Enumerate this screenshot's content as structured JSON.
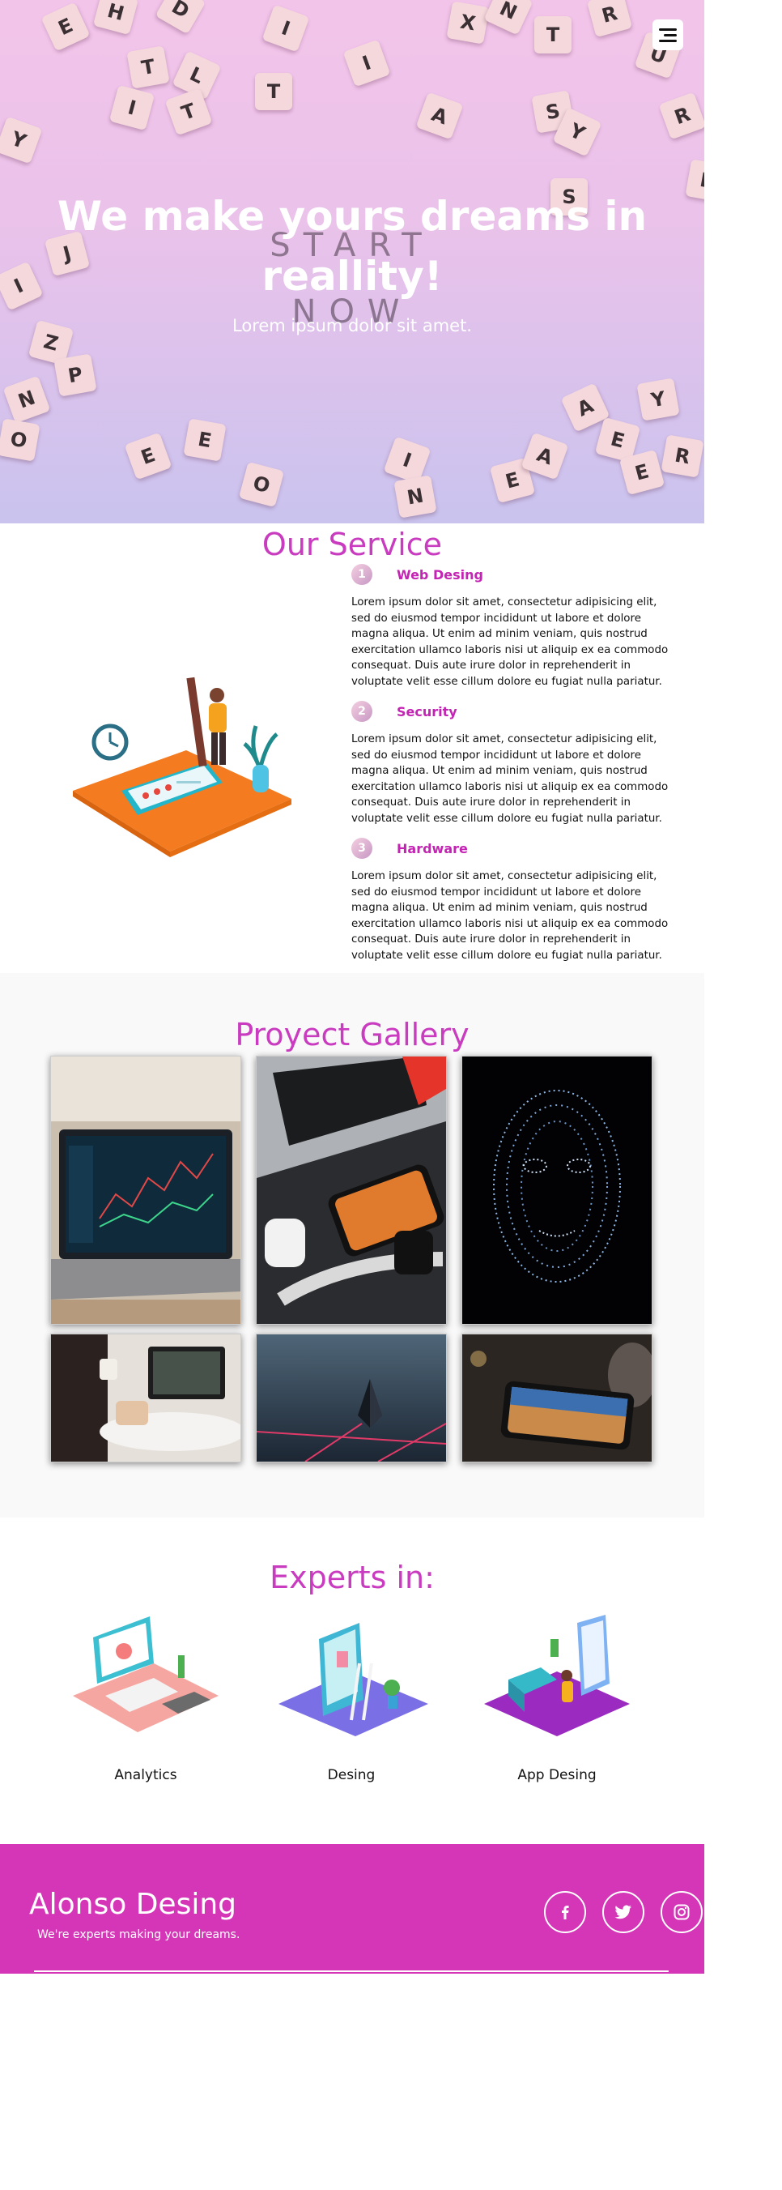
{
  "hero": {
    "title_line1": "We make yours dreams in",
    "title_line2": "reallity!",
    "subtitle": "Lorem ipsum dolor sit amet.",
    "bg_word_1": "START",
    "bg_word_2": "NOW",
    "menu_icon": "hamburger-icon",
    "tile_letters": [
      "E",
      "H",
      "D",
      "I",
      "I",
      "X",
      "N",
      "T",
      "R",
      "U",
      "T",
      "L",
      "I",
      "T",
      "T",
      "A",
      "S",
      "Y",
      "R",
      "E",
      "Y",
      "J",
      "I",
      "Z",
      "N",
      "O",
      "P",
      "E",
      "E",
      "O",
      "I",
      "N",
      "E",
      "A",
      "A",
      "E",
      "Y",
      "R",
      "S",
      "E"
    ]
  },
  "services": {
    "title": "Our Service",
    "items": [
      {
        "num": "1",
        "name": "Web Desing",
        "text": "Lorem ipsum dolor sit amet, consectetur adipisicing elit, sed do eiusmod tempor incididunt ut labore et dolore magna aliqua. Ut enim ad minim veniam, quis nostrud exercitation ullamco laboris nisi ut aliquip ex ea commodo consequat. Duis aute irure dolor in reprehenderit in voluptate velit esse cillum dolore eu fugiat nulla pariatur."
      },
      {
        "num": "2",
        "name": "Security",
        "text": "Lorem ipsum dolor sit amet, consectetur adipisicing elit, sed do eiusmod tempor incididunt ut labore et dolore magna aliqua. Ut enim ad minim veniam, quis nostrud exercitation ullamco laboris nisi ut aliquip ex ea commodo consequat. Duis aute irure dolor in reprehenderit in voluptate velit esse cillum dolore eu fugiat nulla pariatur."
      },
      {
        "num": "3",
        "name": "Hardware",
        "text": "Lorem ipsum dolor sit amet, consectetur adipisicing elit, sed do eiusmod tempor incididunt ut labore et dolore magna aliqua. Ut enim ad minim veniam, quis nostrud exercitation ullamco laboris nisi ut aliquip ex ea commodo consequat. Duis aute irure dolor in reprehenderit in voluptate velit esse cillum dolore eu fugiat nulla pariatur."
      }
    ]
  },
  "gallery": {
    "title": "Proyect Gallery",
    "images": [
      "laptop-trading-chart",
      "laptop-phone-airpods-watch",
      "digital-face-dots",
      "person-laptop-coffee",
      "ethereum-neon-grid",
      "tablet-dark-desk"
    ]
  },
  "experts": {
    "title": "Experts in:",
    "items": [
      {
        "label": "Analytics",
        "icon": "analytics-illustration"
      },
      {
        "label": "Desing",
        "icon": "design-illustration"
      },
      {
        "label": "App Desing",
        "icon": "app-design-illustration"
      }
    ]
  },
  "footer": {
    "brand": "Alonso Desing",
    "tagline": "We're experts making your dreams.",
    "social": [
      "facebook-icon",
      "twitter-icon",
      "instagram-icon"
    ]
  },
  "colors": {
    "accent": "#c93cc0",
    "footer_bg": "#d535b7",
    "hero_top": "#f3c4ea",
    "hero_bottom": "#c9c3ee"
  }
}
